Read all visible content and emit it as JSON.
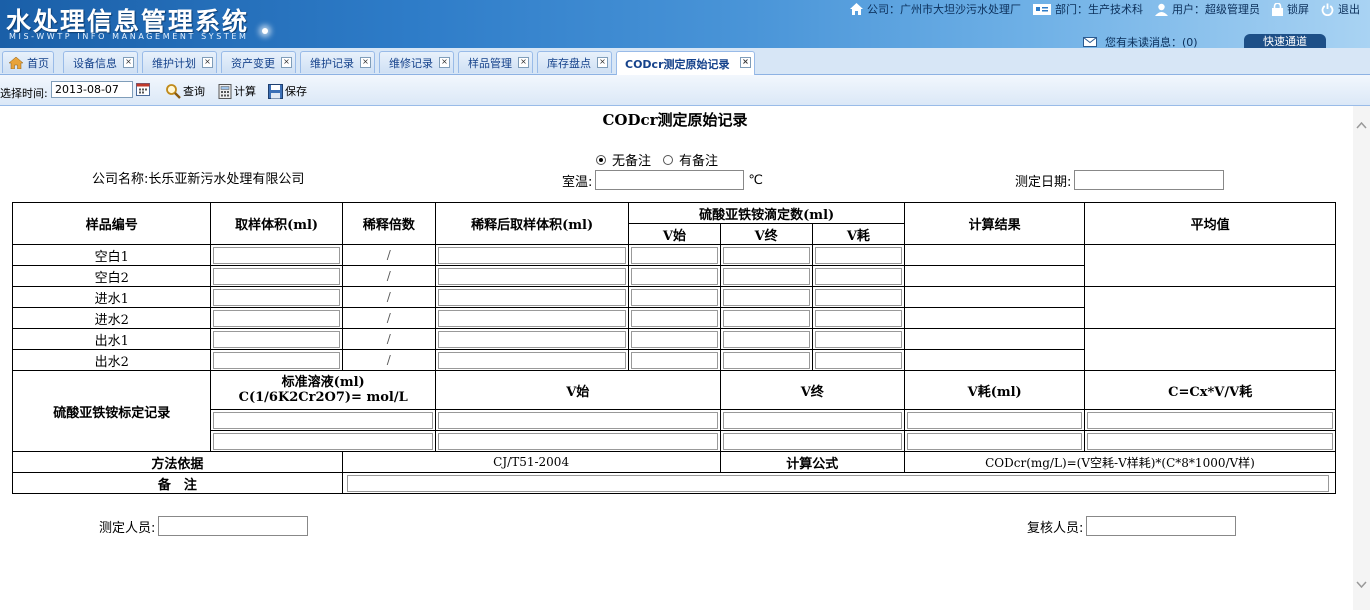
{
  "header": {
    "app_title": "水处理信息管理系统",
    "app_subtitle": "MIS-WWTP INFO MANAGEMENT SYSTEM",
    "company": "公司：广州市大坦沙污水处理厂",
    "department": "部门：生产技术科",
    "user": "用户：超级管理员",
    "lock": "锁屏",
    "logout": "退出",
    "messages": "您有未读消息：(0)",
    "quick_channel": "快速通道"
  },
  "tabs": [
    {
      "label": "首页"
    },
    {
      "label": "设备信息"
    },
    {
      "label": "维护计划"
    },
    {
      "label": "资产变更"
    },
    {
      "label": "维护记录"
    },
    {
      "label": "维修记录"
    },
    {
      "label": "样品管理"
    },
    {
      "label": "库存盘点"
    },
    {
      "label": "CODcr测定原始记录"
    }
  ],
  "toolbar": {
    "date_label": "选择时间:",
    "date_value": "2013-08-07",
    "query": "查询",
    "calculate": "计算",
    "save": "保存"
  },
  "form": {
    "title": "CODcr测定原始记录",
    "radio_none": "无备注",
    "radio_has": "有备注",
    "company": "公司名称:长乐亚新污水处理有限公司",
    "room_temp": "室温:",
    "celsius": "℃",
    "test_date": "测定日期:",
    "tester": "测定人员:",
    "reviewer": "复核人员:"
  },
  "table": {
    "h_sample": "样品编号",
    "h_volume": "取样体积(ml)",
    "h_dilution": "稀释倍数",
    "h_diluted_volume": "稀释后取样体积(ml)",
    "h_titration": "硫酸亚铁铵滴定数(ml)",
    "h_v_start": "V始",
    "h_v_end": "V终",
    "h_v_used": "V耗",
    "h_result": "计算结果",
    "h_avg": "平均值",
    "samples": [
      "空白1",
      "空白2",
      "进水1",
      "进水2",
      "出水1",
      "出水2"
    ],
    "slash": "/",
    "calib_title": "硫酸亚铁铵标定记录",
    "std_solution": "标准溶液(ml)",
    "std_conc": "C(1/6K2Cr2O7)= mol/L",
    "c_v_start": "V始",
    "c_v_end": "V终",
    "c_v_used": "V耗(ml)",
    "c_formula": "C=Cx*V/V耗",
    "method_label": "方法依据",
    "method_value": "CJ/T51-2004",
    "formula_label": "计算公式",
    "formula_value": "CODcr(mg/L)=(V空耗-V样耗)*(C*8*1000/V样)",
    "remark_label": "备　注"
  }
}
